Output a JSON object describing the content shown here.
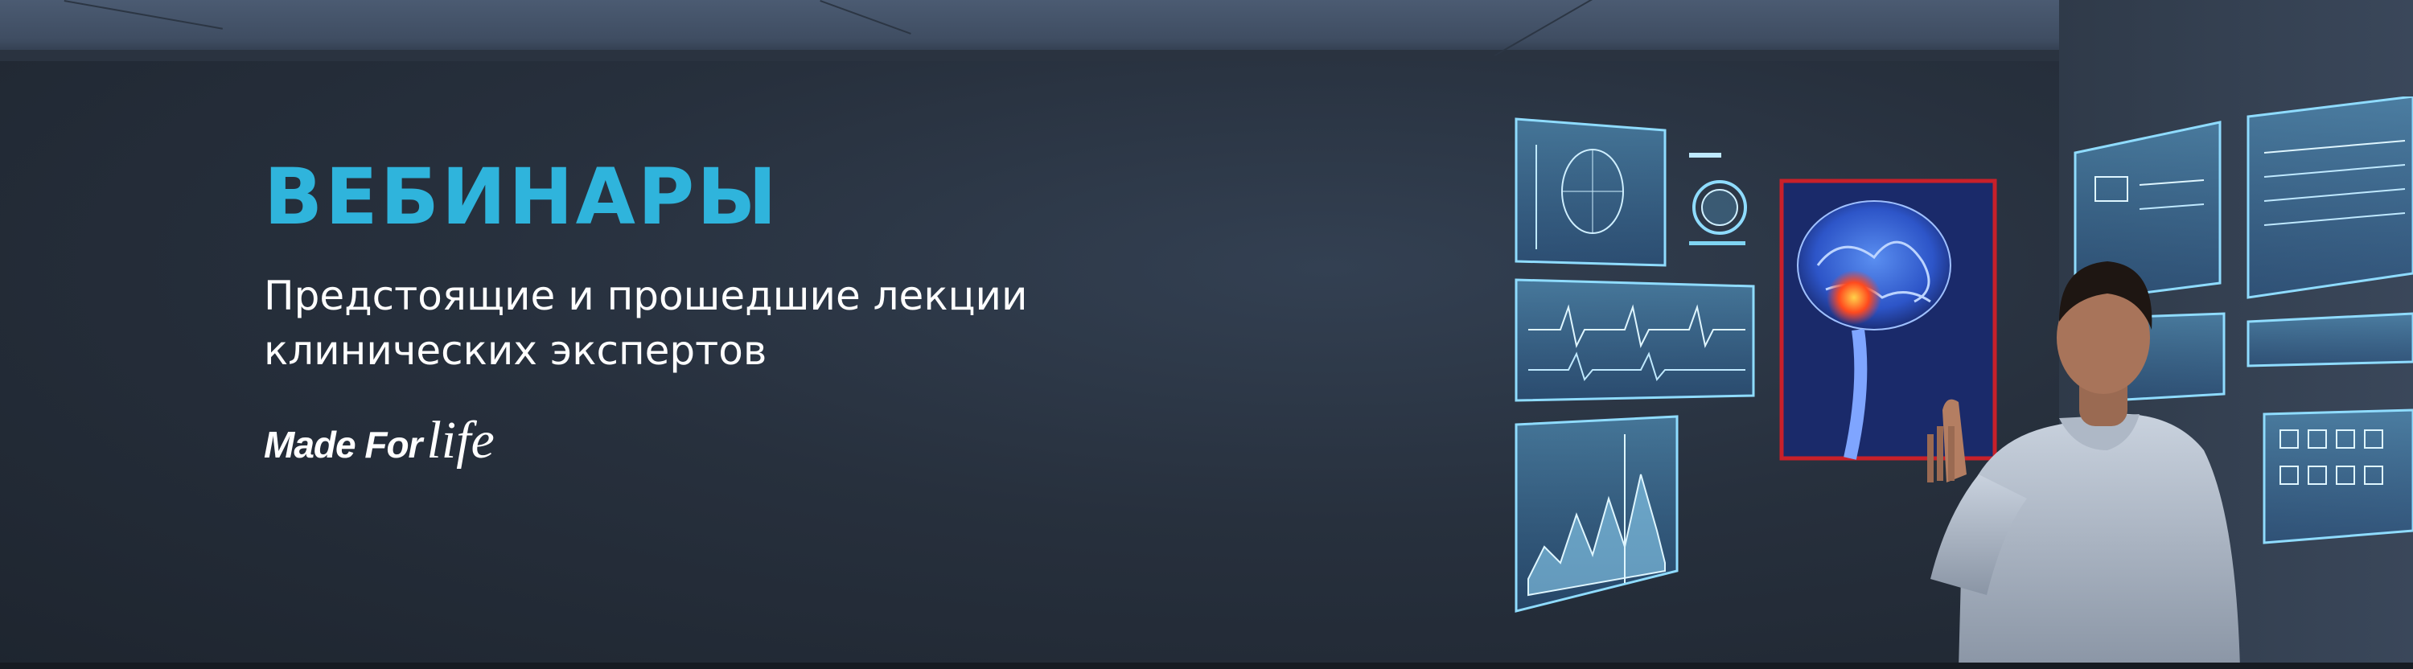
{
  "banner": {
    "title": "ВЕБИНАРЫ",
    "subtitle_line1": "Предстоящие и прошедшие лекции",
    "subtitle_line2": "клинических экспертов",
    "logo_part1": "Made For",
    "logo_part2": "life"
  },
  "colors": {
    "title": "#2fb4dc",
    "text": "#ffffff",
    "background": "#262d38",
    "hologram": "#7fd4f2",
    "brain_frame": "#c8202a"
  }
}
